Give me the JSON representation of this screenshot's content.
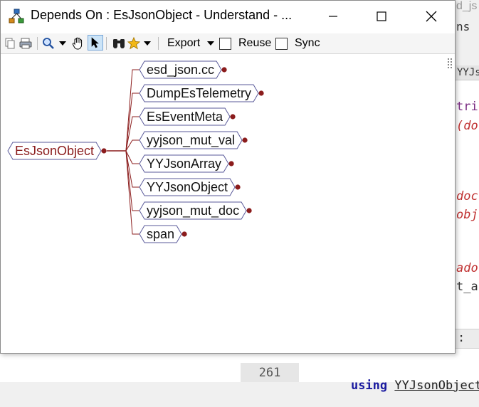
{
  "window": {
    "title": "Depends On : EsJsonObject - Understand - ...",
    "controls": [
      "minimize",
      "maximize",
      "close"
    ]
  },
  "toolbar": {
    "icons": [
      "copy-icon",
      "print-icon",
      "zoom-icon",
      "pan-hand-icon",
      "select-arrow-icon",
      "binoculars-icon",
      "star-icon"
    ],
    "export_label": "Export",
    "reuse_label": "Reuse",
    "reuse_checked": false,
    "sync_label": "Sync",
    "sync_checked": false
  },
  "graph": {
    "root": "EsJsonObject",
    "children": [
      "esd_json.cc",
      "DumpEsTelemetry",
      "EsEventMeta",
      "yyjson_mut_val",
      "YYJsonArray",
      "YYJsonObject",
      "yyjson_mut_doc",
      "span"
    ],
    "colors": {
      "edge": "#8b1c1c",
      "node_border": "#5a5a9a",
      "dot": "#8b1c1c"
    }
  },
  "background_editor": {
    "lines": [
      "d_js",
      "ns",
      "YYJs",
      "tri",
      "(do",
      "doc",
      "obj",
      "ado",
      "t_a",
      ":"
    ],
    "line_number": "261",
    "code_keyword": "using",
    "code_identifier": "YYJsonObject"
  }
}
